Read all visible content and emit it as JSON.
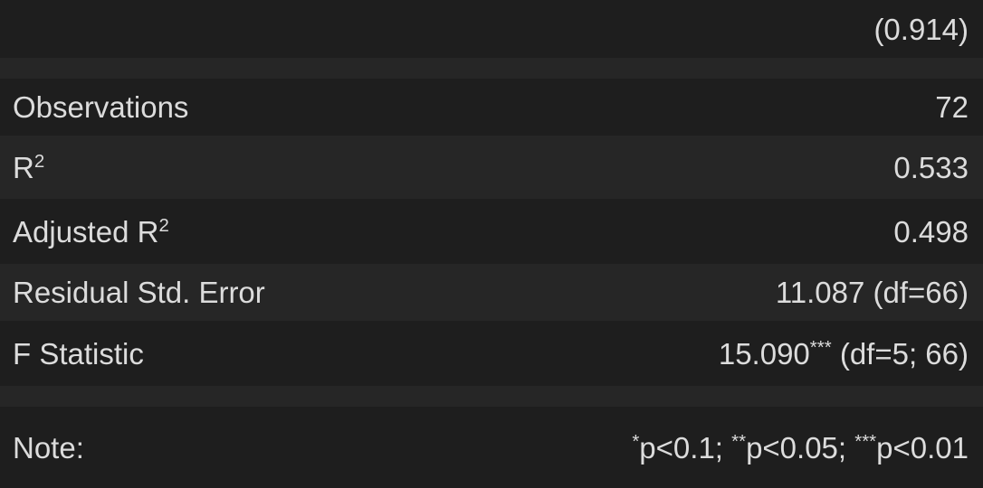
{
  "coef_row": {
    "value": "(0.914)"
  },
  "stats": {
    "observations": {
      "label": "Observations",
      "value": "72"
    },
    "r2": {
      "label": "R",
      "sup": "2",
      "value": "0.533"
    },
    "adj_r2": {
      "label": "Adjusted R",
      "sup": "2",
      "value": "0.498"
    },
    "rse": {
      "label": "Residual Std. Error",
      "value": "11.087 (df=66)"
    },
    "f_stat": {
      "label": "F Statistic",
      "value": "15.090",
      "stars": "***",
      "df": " (df=5; 66)"
    }
  },
  "note": {
    "label": "Note:",
    "p1_stars": "*",
    "p1": "p<0.1; ",
    "p2_stars": "**",
    "p2": "p<0.05; ",
    "p3_stars": "***",
    "p3": "p<0.01"
  },
  "colors": {
    "background": "#1c1c1c",
    "row_alt": "#262626",
    "text": "#dcdcdc"
  }
}
